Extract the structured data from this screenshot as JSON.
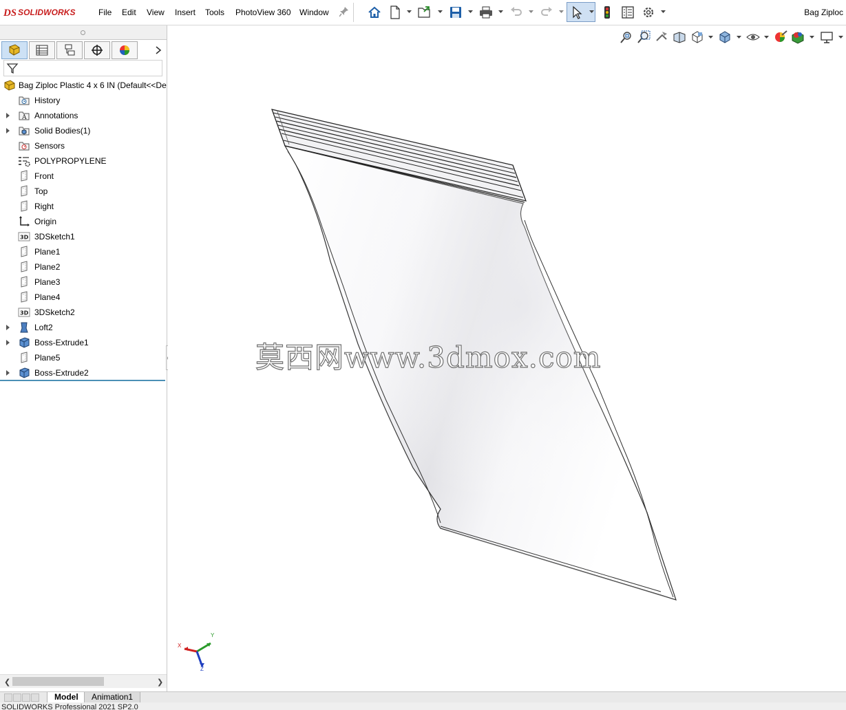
{
  "app": {
    "brand": "SOLIDWORKS",
    "document_title": "Bag Ziploc",
    "brand_color": "#c81e1e"
  },
  "menu": [
    "File",
    "Edit",
    "View",
    "Insert",
    "Tools",
    "PhotoView 360",
    "Window"
  ],
  "toolbar": {
    "icons": [
      "home-icon",
      "new-document-icon",
      "open-icon",
      "save-icon",
      "print-icon",
      "undo-icon",
      "redo-icon",
      "select-pointer-icon",
      "rebuild-traffic-light-icon",
      "file-properties-icon",
      "options-gear-icon"
    ]
  },
  "feature_manager": {
    "tabs": [
      "featuremanager-tree-icon",
      "property-manager-icon",
      "configuration-manager-icon",
      "dimxpert-manager-icon",
      "display-manager-icon"
    ],
    "root": "Bag Ziploc Plastic 4 x 6 IN  (Default<<De",
    "items": [
      {
        "label": "History",
        "icon": "history-icon",
        "expandable": false
      },
      {
        "label": "Annotations",
        "icon": "annotations-icon",
        "expandable": true
      },
      {
        "label": "Solid Bodies(1)",
        "icon": "solid-bodies-icon",
        "expandable": true
      },
      {
        "label": "Sensors",
        "icon": "sensors-icon",
        "expandable": false
      },
      {
        "label": "POLYPROPYLENE",
        "icon": "material-icon",
        "expandable": false
      },
      {
        "label": "Front",
        "icon": "plane-icon",
        "expandable": false
      },
      {
        "label": "Top",
        "icon": "plane-icon",
        "expandable": false
      },
      {
        "label": "Right",
        "icon": "plane-icon",
        "expandable": false
      },
      {
        "label": "Origin",
        "icon": "origin-icon",
        "expandable": false
      },
      {
        "label": "3DSketch1",
        "icon": "3d-sketch-icon",
        "expandable": false
      },
      {
        "label": "Plane1",
        "icon": "plane-icon",
        "expandable": false
      },
      {
        "label": "Plane2",
        "icon": "plane-icon",
        "expandable": false
      },
      {
        "label": "Plane3",
        "icon": "plane-icon",
        "expandable": false
      },
      {
        "label": "Plane4",
        "icon": "plane-icon",
        "expandable": false
      },
      {
        "label": "3DSketch2",
        "icon": "3d-sketch-icon",
        "expandable": false
      },
      {
        "label": "Loft2",
        "icon": "loft-icon",
        "expandable": true
      },
      {
        "label": "Boss-Extrude1",
        "icon": "extrude-icon",
        "expandable": true
      },
      {
        "label": "Plane5",
        "icon": "plane-icon",
        "expandable": false
      },
      {
        "label": "Boss-Extrude2",
        "icon": "extrude-icon",
        "expandable": true
      }
    ]
  },
  "viewport": {
    "heads_up_icons": [
      "zoom-to-fit-icon",
      "zoom-to-area-icon",
      "previous-view-icon",
      "section-view-icon",
      "view-orientation-icon",
      "display-style-icon",
      "hide-show-items-icon",
      "edit-appearance-icon",
      "apply-scene-icon",
      "view-settings-icon"
    ],
    "watermark": "莫西网www.3dmox.com",
    "triad": {
      "x": "X",
      "y": "Y",
      "z": "Z"
    }
  },
  "bottom_tabs": [
    "Model",
    "Animation1"
  ],
  "status": "SOLIDWORKS Professional 2021 SP2.0"
}
